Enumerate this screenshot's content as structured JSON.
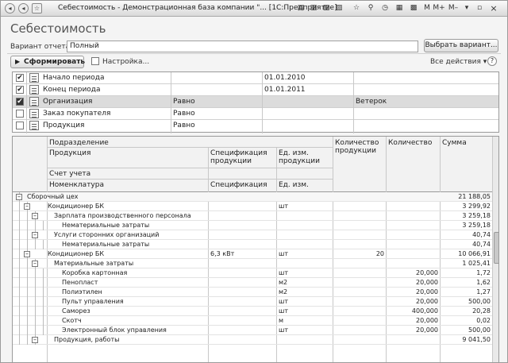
{
  "window": {
    "title": "Себестоимость - Демонстрационная база компании \"... [1С:Предприятие]",
    "title_buttons": [
      "M",
      "M+",
      "M–"
    ],
    "close": "×"
  },
  "heading": "Себестоимость",
  "variant": {
    "label": "Вариант отчета:",
    "value": "Полный",
    "choose_label": "Выбрать вариант..."
  },
  "toolbar": {
    "generate_label": "Сформировать",
    "settings_label": "Настройка...",
    "all_actions_label": "Все действия ▾",
    "help": "?"
  },
  "filters": [
    {
      "checked": true,
      "name": "Начало периода",
      "cond": "",
      "value": "01.01.2010",
      "selected": false
    },
    {
      "checked": true,
      "name": "Конец периода",
      "cond": "",
      "value": "01.01.2011",
      "selected": false
    },
    {
      "checked": true,
      "name": "Организация",
      "cond": "Равно",
      "value": "Ветерок",
      "selected": true
    },
    {
      "checked": false,
      "name": "Заказ покупателя",
      "cond": "Равно",
      "value": "",
      "selected": false
    },
    {
      "checked": false,
      "name": "Продукция",
      "cond": "Равно",
      "value": "",
      "selected": false
    }
  ],
  "report_header": {
    "division": "Подразделение",
    "product": "Продукция",
    "spec": "Спецификация продукции",
    "unit": "Ед. изм. продукции",
    "qty_product": "Количество продукции",
    "qty": "Количество",
    "sum": "Сумма",
    "account": "Счет учета",
    "nomenclature": "Номенклатура",
    "spec2": "Спецификация",
    "unit2": "Ед. изм."
  },
  "rows": [
    {
      "level": 0,
      "tree": "–",
      "name": "Сборочный цех",
      "spec": "",
      "unit": "",
      "qp": "",
      "qty": "",
      "sum": "21 188,05"
    },
    {
      "level": 1,
      "tree": "–",
      "name": "Кондиционер БК",
      "spec": "",
      "unit": "шт",
      "qp": "",
      "qty": "",
      "sum": "3 299,92"
    },
    {
      "level": 2,
      "tree": "–",
      "name": "Зарплата производственного персонала",
      "spec": "",
      "unit": "",
      "qp": "",
      "qty": "",
      "sum": "3 259,18"
    },
    {
      "level": 3,
      "tree": "",
      "name": "Нематериальные затраты",
      "spec": "",
      "unit": "",
      "qp": "",
      "qty": "",
      "sum": "3 259,18"
    },
    {
      "level": 2,
      "tree": "–",
      "name": "Услуги сторонних организаций",
      "spec": "",
      "unit": "",
      "qp": "",
      "qty": "",
      "sum": "40,74"
    },
    {
      "level": 3,
      "tree": "",
      "name": "Нематериальные затраты",
      "spec": "",
      "unit": "",
      "qp": "",
      "qty": "",
      "sum": "40,74"
    },
    {
      "level": 1,
      "tree": "–",
      "name": "Кондиционер БК",
      "spec": "6,3 кВт",
      "unit": "шт",
      "qp": "20",
      "qty": "",
      "sum": "10 066,91"
    },
    {
      "level": 2,
      "tree": "–",
      "name": "Материальные затраты",
      "spec": "",
      "unit": "",
      "qp": "",
      "qty": "",
      "sum": "1 025,41"
    },
    {
      "level": 3,
      "tree": "",
      "name": "Коробка картонная",
      "spec": "",
      "unit": "шт",
      "qp": "",
      "qty": "20,000",
      "sum": "1,72"
    },
    {
      "level": 3,
      "tree": "",
      "name": "Пенопласт",
      "spec": "",
      "unit": "м2",
      "qp": "",
      "qty": "20,000",
      "sum": "1,62"
    },
    {
      "level": 3,
      "tree": "",
      "name": "Полиэтилен",
      "spec": "",
      "unit": "м2",
      "qp": "",
      "qty": "20,000",
      "sum": "1,27"
    },
    {
      "level": 3,
      "tree": "",
      "name": "Пульт управления",
      "spec": "",
      "unit": "шт",
      "qp": "",
      "qty": "20,000",
      "sum": "500,00"
    },
    {
      "level": 3,
      "tree": "",
      "name": "Саморез",
      "spec": "",
      "unit": "шт",
      "qp": "",
      "qty": "400,000",
      "sum": "20,28"
    },
    {
      "level": 3,
      "tree": "",
      "name": "Скотч",
      "spec": "",
      "unit": "м",
      "qp": "",
      "qty": "20,000",
      "sum": "0,02"
    },
    {
      "level": 3,
      "tree": "",
      "name": "Электронный блок управления",
      "spec": "",
      "unit": "шт",
      "qp": "",
      "qty": "20,000",
      "sum": "500,00"
    },
    {
      "level": 2,
      "tree": "–",
      "name": "Продукция, работы",
      "spec": "",
      "unit": "",
      "qp": "",
      "qty": "",
      "sum": "9 041,50"
    }
  ]
}
